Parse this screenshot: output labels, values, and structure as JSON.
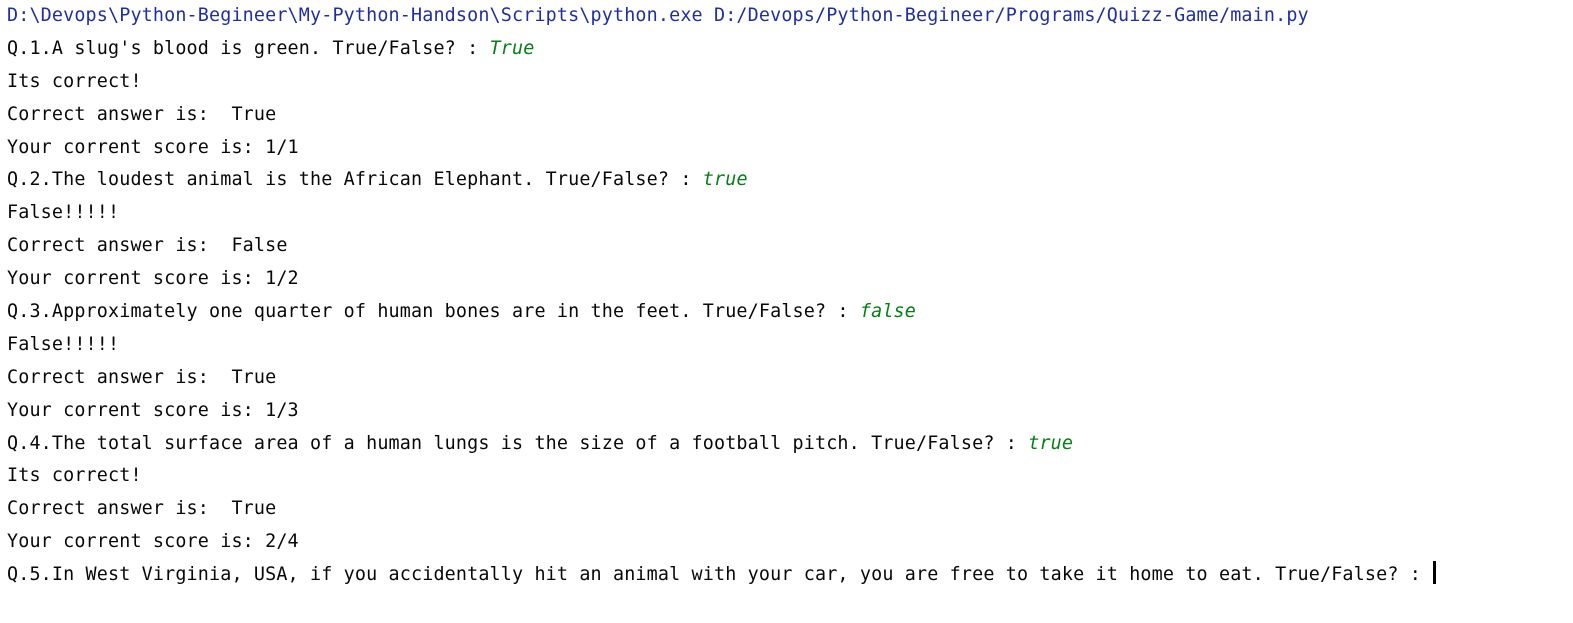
{
  "console": {
    "command": "D:\\Devops\\Python-Begineer\\My-Python-Handson\\Scripts\\python.exe D:/Devops/Python-Begineer/Programs/Quizz-Game/main.py",
    "rounds": [
      {
        "question": "Q.1.A slug's blood is green. True/False? : ",
        "answer": "True",
        "verdict": "Its correct!",
        "correct_answer": "Correct answer is:  True",
        "score": "Your corrent score is: 1/1"
      },
      {
        "question": "Q.2.The loudest animal is the African Elephant. True/False? : ",
        "answer": "true",
        "verdict": "False!!!!!",
        "correct_answer": "Correct answer is:  False",
        "score": "Your corrent score is: 1/2"
      },
      {
        "question": "Q.3.Approximately one quarter of human bones are in the feet. True/False? : ",
        "answer": "false",
        "verdict": "False!!!!!",
        "correct_answer": "Correct answer is:  True",
        "score": "Your corrent score is: 1/3"
      },
      {
        "question": "Q.4.The total surface area of a human lungs is the size of a football pitch. True/False? : ",
        "answer": "true",
        "verdict": "Its correct!",
        "correct_answer": "Correct answer is:  True",
        "score": "Your corrent score is: 2/4"
      }
    ],
    "pending_question": "Q.5.In West Virginia, USA, if you accidentally hit an animal with your car, you are free to take it home to eat. True/False? : ",
    "colors": {
      "command": "#1f2fa0",
      "output": "#080808",
      "user_input": "#067d17"
    }
  }
}
